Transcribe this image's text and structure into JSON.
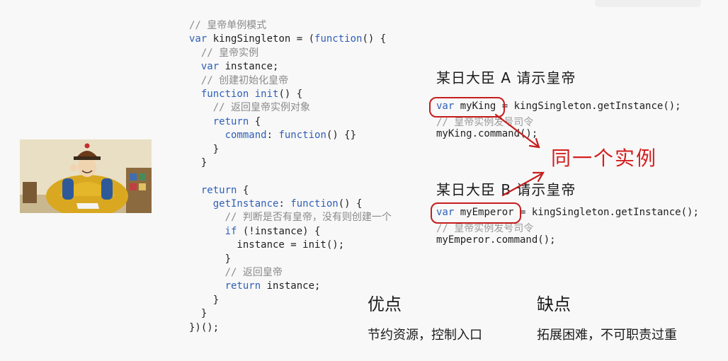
{
  "code": {
    "lines": [
      {
        "parts": [
          {
            "t": "// 皇帝单例模式",
            "c": "cm"
          }
        ]
      },
      {
        "parts": [
          {
            "t": "var",
            "c": "kw"
          },
          {
            "t": " kingSingleton = (",
            "c": "pl"
          },
          {
            "t": "function",
            "c": "kw"
          },
          {
            "t": "() {",
            "c": "pl"
          }
        ]
      },
      {
        "parts": [
          {
            "t": "  // 皇帝实例",
            "c": "cm"
          }
        ]
      },
      {
        "parts": [
          {
            "t": "  ",
            "c": "pl"
          },
          {
            "t": "var",
            "c": "kw"
          },
          {
            "t": " instance;",
            "c": "pl"
          }
        ]
      },
      {
        "parts": [
          {
            "t": "  // 创建初始化皇帝",
            "c": "cm"
          }
        ]
      },
      {
        "parts": [
          {
            "t": "  ",
            "c": "pl"
          },
          {
            "t": "function",
            "c": "kw"
          },
          {
            "t": " init",
            "c": "kw"
          },
          {
            "t": "() {",
            "c": "pl"
          }
        ]
      },
      {
        "parts": [
          {
            "t": "    // 返回皇帝实例对象",
            "c": "cm"
          }
        ]
      },
      {
        "parts": [
          {
            "t": "    ",
            "c": "pl"
          },
          {
            "t": "return",
            "c": "kw"
          },
          {
            "t": " {",
            "c": "pl"
          }
        ]
      },
      {
        "parts": [
          {
            "t": "      ",
            "c": "pl"
          },
          {
            "t": "command",
            "c": "kw"
          },
          {
            "t": ": ",
            "c": "pl"
          },
          {
            "t": "function",
            "c": "kw"
          },
          {
            "t": "() {}",
            "c": "pl"
          }
        ]
      },
      {
        "parts": [
          {
            "t": "    }",
            "c": "pl"
          }
        ]
      },
      {
        "parts": [
          {
            "t": "  }",
            "c": "pl"
          }
        ]
      },
      {
        "parts": [
          {
            "t": "",
            "c": "pl"
          }
        ]
      },
      {
        "parts": [
          {
            "t": "  ",
            "c": "pl"
          },
          {
            "t": "return",
            "c": "kw"
          },
          {
            "t": " {",
            "c": "pl"
          }
        ]
      },
      {
        "parts": [
          {
            "t": "    ",
            "c": "pl"
          },
          {
            "t": "getInstance",
            "c": "kw"
          },
          {
            "t": ": ",
            "c": "pl"
          },
          {
            "t": "function",
            "c": "kw"
          },
          {
            "t": "() {",
            "c": "pl"
          }
        ]
      },
      {
        "parts": [
          {
            "t": "      // 判断是否有皇帝，没有则创建一个",
            "c": "cm"
          }
        ]
      },
      {
        "parts": [
          {
            "t": "      ",
            "c": "pl"
          },
          {
            "t": "if",
            "c": "kw"
          },
          {
            "t": " (!instance) {",
            "c": "pl"
          }
        ]
      },
      {
        "parts": [
          {
            "t": "        instance = init();",
            "c": "pl"
          }
        ]
      },
      {
        "parts": [
          {
            "t": "      }",
            "c": "pl"
          }
        ]
      },
      {
        "parts": [
          {
            "t": "      // 返回皇帝",
            "c": "cm"
          }
        ]
      },
      {
        "parts": [
          {
            "t": "      ",
            "c": "pl"
          },
          {
            "t": "return",
            "c": "kw"
          },
          {
            "t": " instance;",
            "c": "pl"
          }
        ]
      },
      {
        "parts": [
          {
            "t": "    }",
            "c": "pl"
          }
        ]
      },
      {
        "parts": [
          {
            "t": "  }",
            "c": "pl"
          }
        ]
      },
      {
        "parts": [
          {
            "t": "})();",
            "c": "pl"
          }
        ]
      }
    ]
  },
  "right": {
    "heading_a": "某日大臣 A 请示皇帝",
    "heading_b": "某日大臣 B 请示皇帝",
    "same_instance": "同一个实例",
    "code_a": {
      "line1_kw": "var",
      "line1_var": " myKing",
      "line1_rest": " = kingSingleton.getInstance();",
      "line2": "// 皇帝实例发号司令",
      "line3": "myKing.command();"
    },
    "code_b": {
      "line1_kw": "var",
      "line1_var": " myEmperor",
      "line1_rest": " = kingSingleton.getInstance();",
      "line2": "// 皇帝实例发号司令",
      "line3": "myEmperor.command();"
    }
  },
  "pros": {
    "title": "优点",
    "text": "节约资源，控制入口"
  },
  "cons": {
    "title": "缺点",
    "text": "拓展困难，不可职责过重"
  },
  "colors": {
    "keyword": "#2f5fb8",
    "comment": "#8a8a8a",
    "annotation_red": "#c61d1d"
  },
  "icons": {
    "portrait": "emperor-portrait-image"
  }
}
